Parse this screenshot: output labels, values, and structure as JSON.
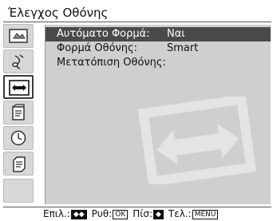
{
  "screen": {
    "title": "Έλεγχος Οθόνης",
    "sidebar_icons": [
      "picture-icon",
      "sound-icon",
      "screen-control-icon",
      "setup-icon",
      "timer-icon",
      "pc-settings-icon",
      "empty-tab"
    ],
    "active_tab_index": 2
  },
  "menu": {
    "items": [
      {
        "label": "Αυτόματο Φορμά:",
        "value": "Ναι",
        "selected": true
      },
      {
        "label": "Φορμά Οθόνης:",
        "value": "Smart",
        "selected": false
      },
      {
        "label": "Μετατόπιση Οθόνης:",
        "value": "",
        "selected": false
      }
    ]
  },
  "footer": {
    "select_label": "Επιλ.:",
    "select_key": "◆◆",
    "confirm_label": "Ρυθ:",
    "confirm_key": "OK",
    "back_label": "Πίσ:",
    "back_key": "◆",
    "exit_label": "Τελ.:",
    "exit_key": "MENU"
  },
  "colors": {
    "panel": "#cfcfcf",
    "highlight": "#4a4a4a",
    "tab": "#d7d7d7"
  }
}
